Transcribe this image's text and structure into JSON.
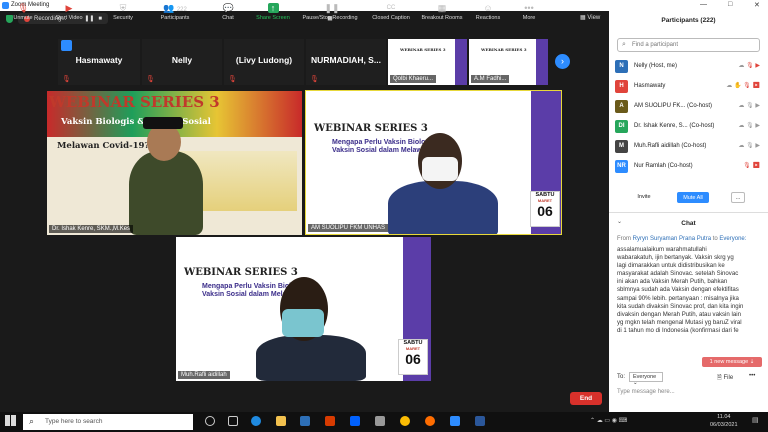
{
  "window": {
    "title": "Zoom Meeting",
    "controls": [
      "—",
      "□",
      "✕"
    ]
  },
  "top": {
    "recording_label": "Recording...",
    "view_label": "View"
  },
  "thumbs": [
    {
      "name": "Hasmawaty"
    },
    {
      "name": "Nelly"
    },
    {
      "name": "(Livy Ludong)"
    },
    {
      "name": "NURMADIAH, S..."
    },
    {
      "name": "Qolbi Khaeru..."
    },
    {
      "name": "A.M Fadhi..."
    }
  ],
  "main_tiles": [
    {
      "name": "Dr. Ishak Kenre, SKM.,M.Kes"
    },
    {
      "name": "AM SUOLIPU FKM UNHAS"
    },
    {
      "name": "Muh.Rafli aidillah"
    }
  ],
  "slide": {
    "title1": "WEBINAR SERIES 3",
    "title2": "Vaksin Biologis & Vaksin Sosial",
    "title3": "Melawan Covid-19?",
    "sub1": "Mengapa Perlu Vaksin Biologis &",
    "sub2": "Vaksin Sosial dalam Melawan",
    "day": "SABTU",
    "month": "MARET",
    "num": "06"
  },
  "toolbar": {
    "unmute": "Unmute",
    "start_video": "Start Video",
    "security": "Security",
    "participants": "Participants",
    "participants_count": "222",
    "chat": "Chat",
    "share": "Share Screen",
    "pause": "Pause/Stop Recording",
    "cc": "Closed Caption",
    "breakout": "Breakout Rooms",
    "reactions": "Reactions",
    "more": "More",
    "end": "End"
  },
  "panel": {
    "participants_title": "Participants (222)",
    "find_placeholder": "Find a participant",
    "participants": [
      {
        "initial": "N",
        "name": "Nelly (Host, me)",
        "color": "#2d6fb7"
      },
      {
        "initial": "H",
        "name": "Hasmawaty",
        "color": "#e0443b"
      },
      {
        "initial": "A",
        "name": "AM SUOLIPU FK... (Co-host)",
        "color": "#6a5a1a"
      },
      {
        "initial": "DI",
        "name": "Dr. Ishak Kenre, S... (Co-host)",
        "color": "#26a65b"
      },
      {
        "initial": "M",
        "name": "Muh.Rafli aidillah (Co-host)",
        "color": "#444"
      },
      {
        "initial": "NR",
        "name": "Nur Ramlah (Co-host)",
        "color": "#2d8cff"
      }
    ],
    "invite": "Invite",
    "mute_all": "Mute All",
    "more": "...",
    "chat_title": "Chat",
    "chat_from": "From",
    "chat_sender": "Ryryn Suryaman Prana Putra",
    "chat_to_word": "to",
    "chat_recipient": "Everyone:",
    "chat_text": "assalamualaikum warahmatullahi wabarakatuh, ijin bertanyak. Vaksin skrg yg lagi dimarakkan untuk didistribusikan ke masyarakat adalah Sinovac. setelah Sinovac ini akan ada Vaksin Merah Putih, bahkan sblmnya sudah ada Vaksin dengan efektifitas sampai 90% lebih. pertanyaan : misalnya jika kita sudah divaksin Sinovac prof, dan kita ingin divaksin dengan Merah Putih, atau vaksin lain yg mgkn telah mengenal Mutasi yg baruZ viral di 1 tahun mo di Indonesia (konfirmasi dari fe",
    "new_message": "1 new message",
    "to_label": "To:",
    "to_value": "Everyone",
    "file": "File",
    "message_placeholder": "Type message here..."
  },
  "taskbar": {
    "search_placeholder": "Type here to search",
    "time": "11.04",
    "date": "06/03/2021"
  }
}
